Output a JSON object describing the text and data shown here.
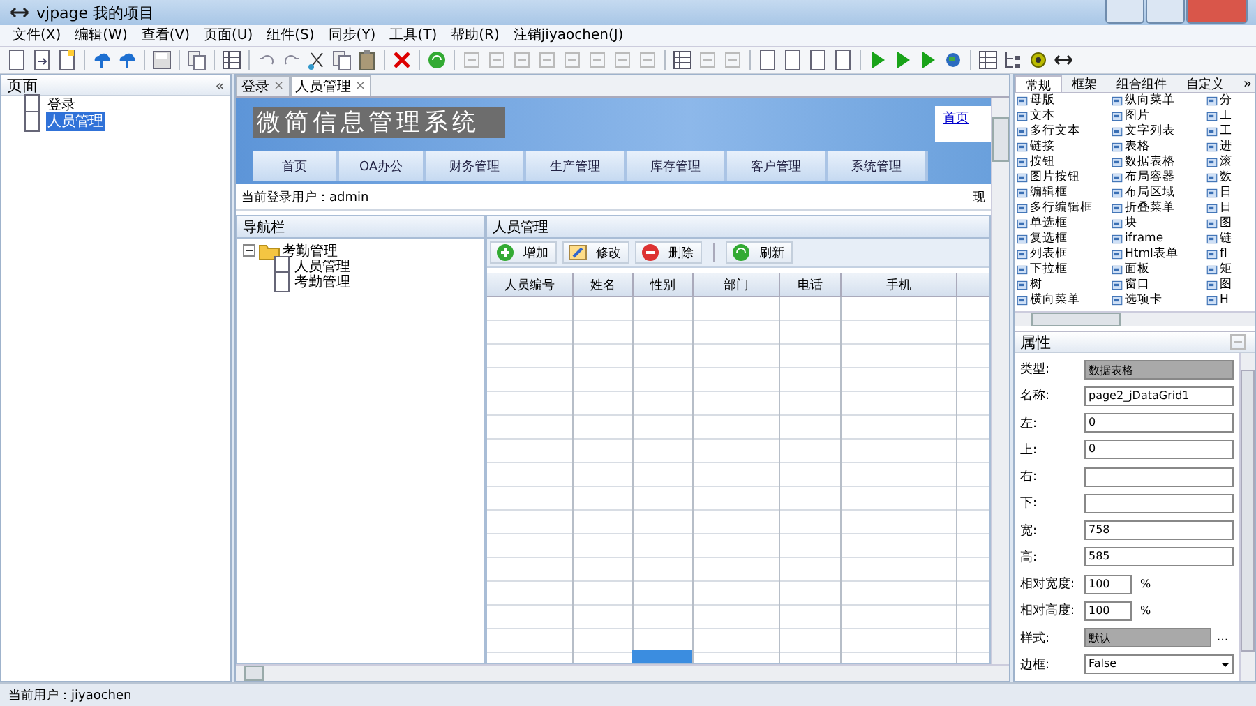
{
  "window": {
    "title": "vjpage 我的项目"
  },
  "menu": [
    "文件(X)",
    "编辑(W)",
    "查看(V)",
    "页面(U)",
    "组件(S)",
    "同步(Y)",
    "工具(T)",
    "帮助(R)",
    "注销jiyaochen(J)"
  ],
  "left_panel": {
    "title": "页面",
    "collapse": "«",
    "items": [
      {
        "label": "登录",
        "selected": false
      },
      {
        "label": "人员管理",
        "selected": true
      }
    ]
  },
  "editor_tabs": [
    {
      "label": "登录",
      "selected": false,
      "close": "×"
    },
    {
      "label": "人员管理",
      "selected": true,
      "close": "×"
    }
  ],
  "page": {
    "banner_title": "微简信息管理系统",
    "home_link": "首页",
    "nav": [
      "首页",
      "OA办公",
      "财务管理",
      "生产管理",
      "库存管理",
      "客户管理",
      "系统管理"
    ],
    "current_user": "当前登录用户：admin",
    "right_text": "现",
    "nav_panel": {
      "title": "导航栏",
      "tree": [
        {
          "label": "考勤管理",
          "expanded": true,
          "children": [
            {
              "label": "人员管理"
            },
            {
              "label": "考勤管理"
            }
          ]
        }
      ]
    },
    "grid_panel": {
      "title": "人员管理",
      "buttons": [
        {
          "label": "增加",
          "kind": "add"
        },
        {
          "label": "修改",
          "kind": "edit"
        },
        {
          "label": "删除",
          "kind": "delete"
        },
        {
          "label": "刷新",
          "kind": "refresh"
        }
      ],
      "columns": [
        "人员编号",
        "姓名",
        "性别",
        "部门",
        "电话",
        "手机"
      ]
    }
  },
  "palette": {
    "tabs": [
      {
        "label": "常规",
        "selected": true
      },
      {
        "label": "框架",
        "selected": false
      },
      {
        "label": "组合组件",
        "selected": false
      },
      {
        "label": "自定义",
        "selected": false
      }
    ],
    "more": "»",
    "columns": [
      [
        "母版",
        "文本",
        "多行文本",
        "链接",
        "按钮",
        "图片按钮",
        "编辑框",
        "多行编辑框",
        "单选框",
        "复选框",
        "列表框",
        "下拉框",
        "树",
        "横向菜单"
      ],
      [
        "纵向菜单",
        "图片",
        "文字列表",
        "表格",
        "数据表格",
        "布局容器",
        "布局区域",
        "折叠菜单",
        "块",
        "iframe",
        "Html表单",
        "面板",
        "窗口",
        "选项卡"
      ],
      [
        "分",
        "工",
        "工",
        "进",
        "滚",
        "数",
        "日",
        "日",
        "图",
        "链",
        "fl",
        "矩",
        "图",
        "H"
      ]
    ]
  },
  "properties": {
    "title": "属性",
    "rows": [
      {
        "label": "类型:",
        "value": "数据表格",
        "kind": "readonly"
      },
      {
        "label": "名称:",
        "value": "page2_jDataGrid1",
        "kind": "text"
      },
      {
        "label": "左:",
        "value": "0",
        "kind": "text"
      },
      {
        "label": "上:",
        "value": "0",
        "kind": "text"
      },
      {
        "label": "右:",
        "kind": "text"
      },
      {
        "label": "下:",
        "kind": "text"
      },
      {
        "label": "宽:",
        "value": "758",
        "kind": "text"
      },
      {
        "label": "高:",
        "value": "585",
        "kind": "text"
      },
      {
        "label": "相对宽度:",
        "value": "100",
        "unit": "%",
        "kind": "percent"
      },
      {
        "label": "相对高度:",
        "value": "100",
        "unit": "%",
        "kind": "percent"
      },
      {
        "label": "样式:",
        "value": "默认",
        "button": "...",
        "kind": "style"
      },
      {
        "label": "边框:",
        "value": "False",
        "kind": "select"
      }
    ]
  },
  "status_bar": "当前用户：jiyaochen"
}
